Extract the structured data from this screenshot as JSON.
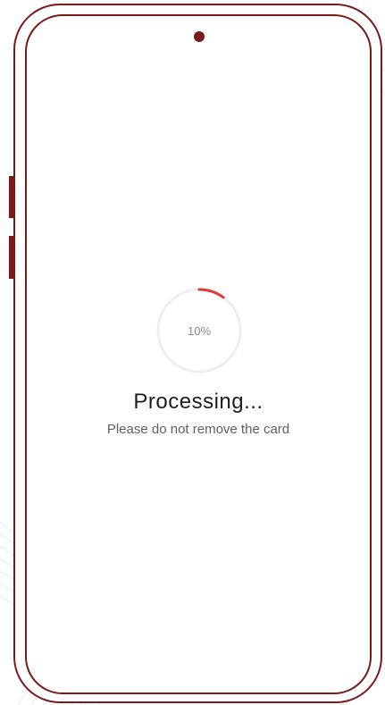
{
  "device": {
    "frame_color": "#7a1a1a"
  },
  "progress": {
    "value": 0.1,
    "label": "10%",
    "track_color": "#eeeeee",
    "fill_color": "#e53935"
  },
  "status": {
    "title": "Processing...",
    "subtitle": "Please do not remove the card"
  }
}
